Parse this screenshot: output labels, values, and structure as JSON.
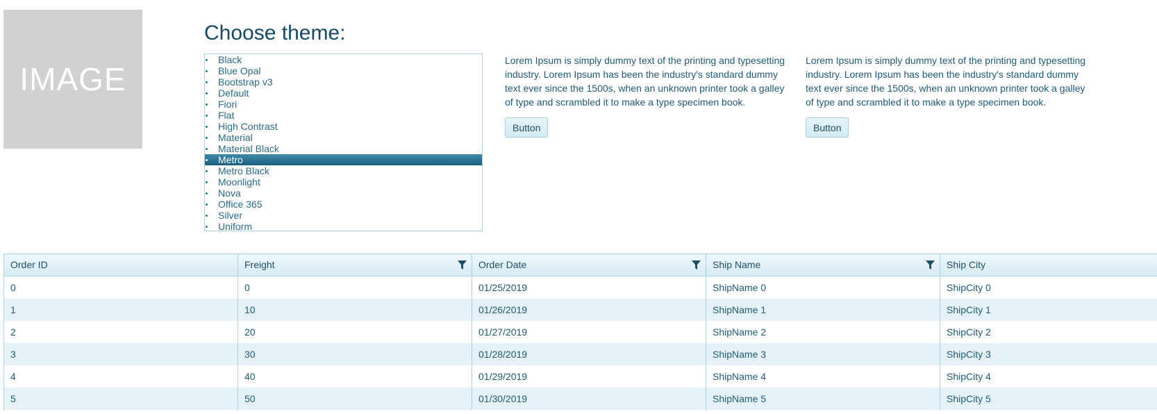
{
  "image_placeholder": {
    "label": "IMAGE"
  },
  "theme_chooser": {
    "title": "Choose theme:",
    "selected": "Metro",
    "items": [
      "Black",
      "Blue Opal",
      "Bootstrap v3",
      "Default",
      "Fiori",
      "Flat",
      "High Contrast",
      "Material",
      "Material Black",
      "Metro",
      "Metro Black",
      "Moonlight",
      "Nova",
      "Office 365",
      "Silver",
      "Uniform"
    ]
  },
  "content": {
    "col1": {
      "text": "Lorem Ipsum is simply dummy text of the printing and typesetting industry. Lorem Ipsum has been the industry's standard dummy text ever since the 1500s, when an unknown printer took a galley of type and scrambled it to make a type specimen book.",
      "button_label": "Button"
    },
    "col2": {
      "text": "Lorem Ipsum is simply dummy text of the printing and typesetting industry. Lorem Ipsum has been the industry's standard dummy text ever since the 1500s, when an unknown printer took a galley of type and scrambled it to make a type specimen book.",
      "button_label": "Button"
    }
  },
  "grid": {
    "columns": [
      {
        "label": "Order ID",
        "filterable": false
      },
      {
        "label": "Freight",
        "filterable": true
      },
      {
        "label": "Order Date",
        "filterable": true
      },
      {
        "label": "Ship Name",
        "filterable": true
      },
      {
        "label": "Ship City",
        "filterable": false
      }
    ],
    "rows": [
      [
        "0",
        "0",
        "01/25/2019",
        "ShipName 0",
        "ShipCity 0"
      ],
      [
        "1",
        "10",
        "01/26/2019",
        "ShipName 1",
        "ShipCity 1"
      ],
      [
        "2",
        "20",
        "01/27/2019",
        "ShipName 2",
        "ShipCity 2"
      ],
      [
        "3",
        "30",
        "01/28/2019",
        "ShipName 3",
        "ShipCity 3"
      ],
      [
        "4",
        "40",
        "01/29/2019",
        "ShipName 4",
        "ShipCity 4"
      ],
      [
        "5",
        "50",
        "01/30/2019",
        "ShipName 5",
        "ShipCity 5"
      ]
    ]
  },
  "colors": {
    "accent": "#1a5f7e",
    "border": "#a9d3e3",
    "alt_row": "#e6f2f8",
    "text": "#1f5b77"
  },
  "icons": {
    "filter": "filter-icon"
  }
}
